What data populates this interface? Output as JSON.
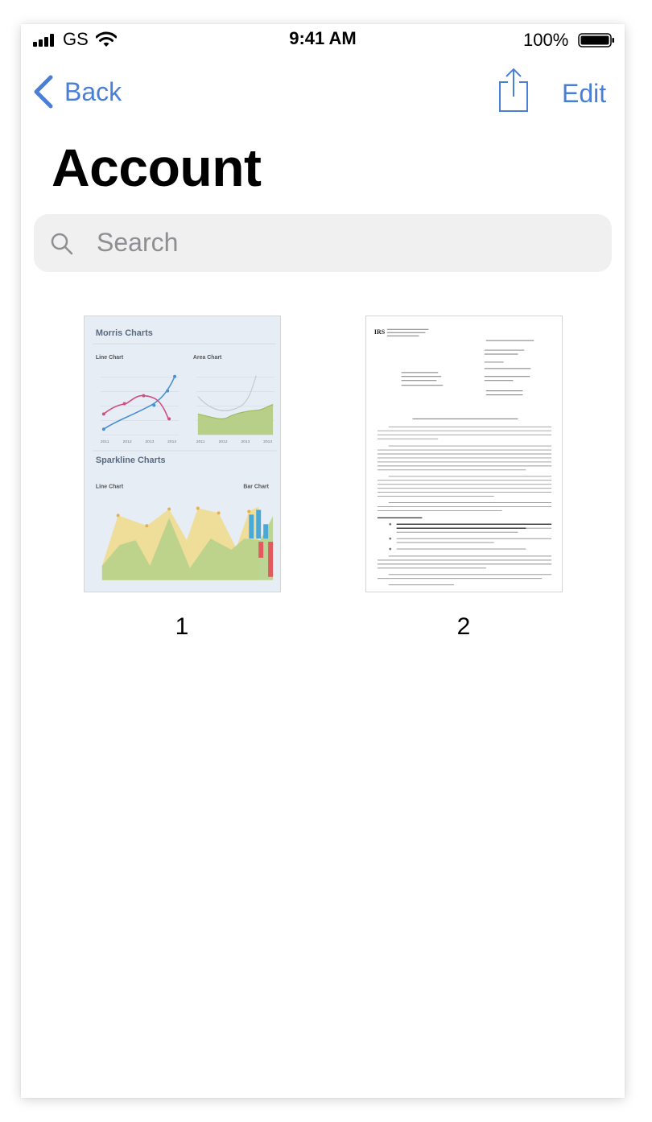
{
  "status_bar": {
    "carrier": "GS",
    "time": "9:41 AM",
    "battery": "100%"
  },
  "nav": {
    "back_label": "Back",
    "edit_label": "Edit"
  },
  "title": "Account",
  "search": {
    "placeholder": "Search"
  },
  "documents": [
    {
      "label": "1",
      "thumbnail": {
        "heading": "Morris Charts",
        "line_chart": "Line Chart",
        "area_chart": "Area Chart",
        "sparkline": "Sparkline Charts",
        "spark_line": "Line Chart",
        "bar_chart": "Bar Chart",
        "x_ticks": [
          "2011",
          "2012",
          "2013",
          "2014"
        ]
      }
    },
    {
      "label": "2",
      "thumbnail": {
        "logo": "IRS"
      }
    }
  ],
  "colors": {
    "accent": "#4a7fd6",
    "search_bg": "#f0f0f0",
    "placeholder": "#8e8e93"
  }
}
